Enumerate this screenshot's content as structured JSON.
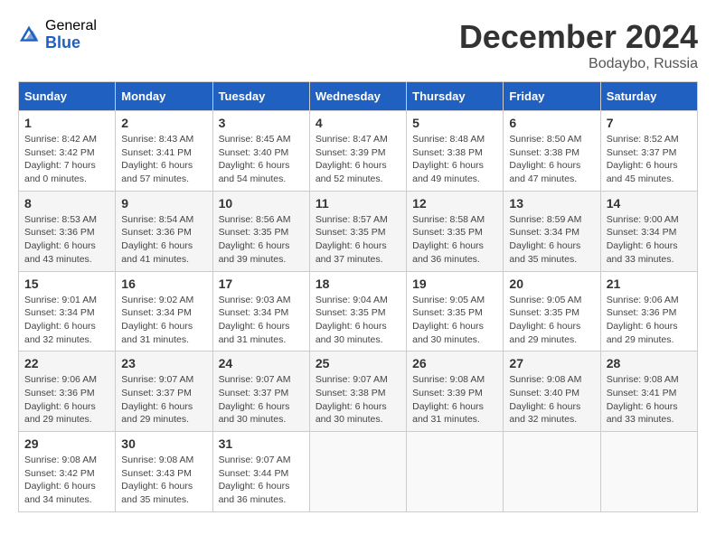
{
  "header": {
    "logo_general": "General",
    "logo_blue": "Blue",
    "month_title": "December 2024",
    "location": "Bodaybo, Russia"
  },
  "days_of_week": [
    "Sunday",
    "Monday",
    "Tuesday",
    "Wednesday",
    "Thursday",
    "Friday",
    "Saturday"
  ],
  "weeks": [
    [
      {
        "day": "1",
        "sunrise": "8:42 AM",
        "sunset": "3:42 PM",
        "daylight": "7 hours and 0 minutes."
      },
      {
        "day": "2",
        "sunrise": "8:43 AM",
        "sunset": "3:41 PM",
        "daylight": "6 hours and 57 minutes."
      },
      {
        "day": "3",
        "sunrise": "8:45 AM",
        "sunset": "3:40 PM",
        "daylight": "6 hours and 54 minutes."
      },
      {
        "day": "4",
        "sunrise": "8:47 AM",
        "sunset": "3:39 PM",
        "daylight": "6 hours and 52 minutes."
      },
      {
        "day": "5",
        "sunrise": "8:48 AM",
        "sunset": "3:38 PM",
        "daylight": "6 hours and 49 minutes."
      },
      {
        "day": "6",
        "sunrise": "8:50 AM",
        "sunset": "3:38 PM",
        "daylight": "6 hours and 47 minutes."
      },
      {
        "day": "7",
        "sunrise": "8:52 AM",
        "sunset": "3:37 PM",
        "daylight": "6 hours and 45 minutes."
      }
    ],
    [
      {
        "day": "8",
        "sunrise": "8:53 AM",
        "sunset": "3:36 PM",
        "daylight": "6 hours and 43 minutes."
      },
      {
        "day": "9",
        "sunrise": "8:54 AM",
        "sunset": "3:36 PM",
        "daylight": "6 hours and 41 minutes."
      },
      {
        "day": "10",
        "sunrise": "8:56 AM",
        "sunset": "3:35 PM",
        "daylight": "6 hours and 39 minutes."
      },
      {
        "day": "11",
        "sunrise": "8:57 AM",
        "sunset": "3:35 PM",
        "daylight": "6 hours and 37 minutes."
      },
      {
        "day": "12",
        "sunrise": "8:58 AM",
        "sunset": "3:35 PM",
        "daylight": "6 hours and 36 minutes."
      },
      {
        "day": "13",
        "sunrise": "8:59 AM",
        "sunset": "3:34 PM",
        "daylight": "6 hours and 35 minutes."
      },
      {
        "day": "14",
        "sunrise": "9:00 AM",
        "sunset": "3:34 PM",
        "daylight": "6 hours and 33 minutes."
      }
    ],
    [
      {
        "day": "15",
        "sunrise": "9:01 AM",
        "sunset": "3:34 PM",
        "daylight": "6 hours and 32 minutes."
      },
      {
        "day": "16",
        "sunrise": "9:02 AM",
        "sunset": "3:34 PM",
        "daylight": "6 hours and 31 minutes."
      },
      {
        "day": "17",
        "sunrise": "9:03 AM",
        "sunset": "3:34 PM",
        "daylight": "6 hours and 31 minutes."
      },
      {
        "day": "18",
        "sunrise": "9:04 AM",
        "sunset": "3:35 PM",
        "daylight": "6 hours and 30 minutes."
      },
      {
        "day": "19",
        "sunrise": "9:05 AM",
        "sunset": "3:35 PM",
        "daylight": "6 hours and 30 minutes."
      },
      {
        "day": "20",
        "sunrise": "9:05 AM",
        "sunset": "3:35 PM",
        "daylight": "6 hours and 29 minutes."
      },
      {
        "day": "21",
        "sunrise": "9:06 AM",
        "sunset": "3:36 PM",
        "daylight": "6 hours and 29 minutes."
      }
    ],
    [
      {
        "day": "22",
        "sunrise": "9:06 AM",
        "sunset": "3:36 PM",
        "daylight": "6 hours and 29 minutes."
      },
      {
        "day": "23",
        "sunrise": "9:07 AM",
        "sunset": "3:37 PM",
        "daylight": "6 hours and 29 minutes."
      },
      {
        "day": "24",
        "sunrise": "9:07 AM",
        "sunset": "3:37 PM",
        "daylight": "6 hours and 30 minutes."
      },
      {
        "day": "25",
        "sunrise": "9:07 AM",
        "sunset": "3:38 PM",
        "daylight": "6 hours and 30 minutes."
      },
      {
        "day": "26",
        "sunrise": "9:08 AM",
        "sunset": "3:39 PM",
        "daylight": "6 hours and 31 minutes."
      },
      {
        "day": "27",
        "sunrise": "9:08 AM",
        "sunset": "3:40 PM",
        "daylight": "6 hours and 32 minutes."
      },
      {
        "day": "28",
        "sunrise": "9:08 AM",
        "sunset": "3:41 PM",
        "daylight": "6 hours and 33 minutes."
      }
    ],
    [
      {
        "day": "29",
        "sunrise": "9:08 AM",
        "sunset": "3:42 PM",
        "daylight": "6 hours and 34 minutes."
      },
      {
        "day": "30",
        "sunrise": "9:08 AM",
        "sunset": "3:43 PM",
        "daylight": "6 hours and 35 minutes."
      },
      {
        "day": "31",
        "sunrise": "9:07 AM",
        "sunset": "3:44 PM",
        "daylight": "6 hours and 36 minutes."
      },
      null,
      null,
      null,
      null
    ]
  ],
  "labels": {
    "sunrise": "Sunrise:",
    "sunset": "Sunset:",
    "daylight": "Daylight:"
  }
}
